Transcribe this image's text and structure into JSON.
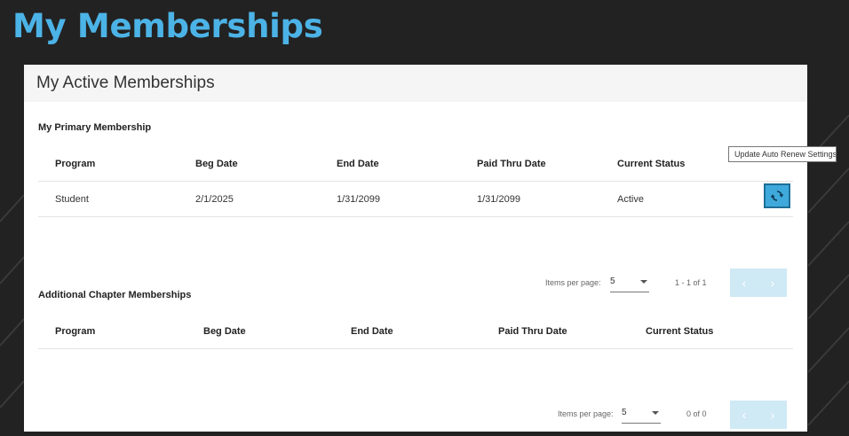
{
  "page": {
    "title": "My Memberships"
  },
  "card": {
    "header": "My Active Memberships"
  },
  "primary": {
    "title": "My Primary Membership",
    "columns": [
      "Program",
      "Beg Date",
      "End Date",
      "Paid Thru Date",
      "Current Status"
    ],
    "rows": [
      {
        "program": "Student",
        "beg_date": "2/1/2025",
        "end_date": "1/31/2099",
        "paid_thru": "1/31/2099",
        "status": "Active"
      }
    ],
    "action_icon": "refresh-icon",
    "tooltip": "Update Auto Renew Settings",
    "paginator": {
      "items_per_page_label": "Items per page:",
      "page_size": "5",
      "range": "1 - 1 of 1"
    }
  },
  "additional": {
    "title": "Additional Chapter Memberships",
    "columns": [
      "Program",
      "Beg Date",
      "End Date",
      "Paid Thru Date",
      "Current Status"
    ],
    "paginator": {
      "items_per_page_label": "Items per page:",
      "page_size": "5",
      "range": "0 of 0"
    }
  },
  "colors": {
    "title": "#4cb3e6",
    "accent": "#3fa9dc",
    "nav_disabled": "#cfe9f5"
  }
}
